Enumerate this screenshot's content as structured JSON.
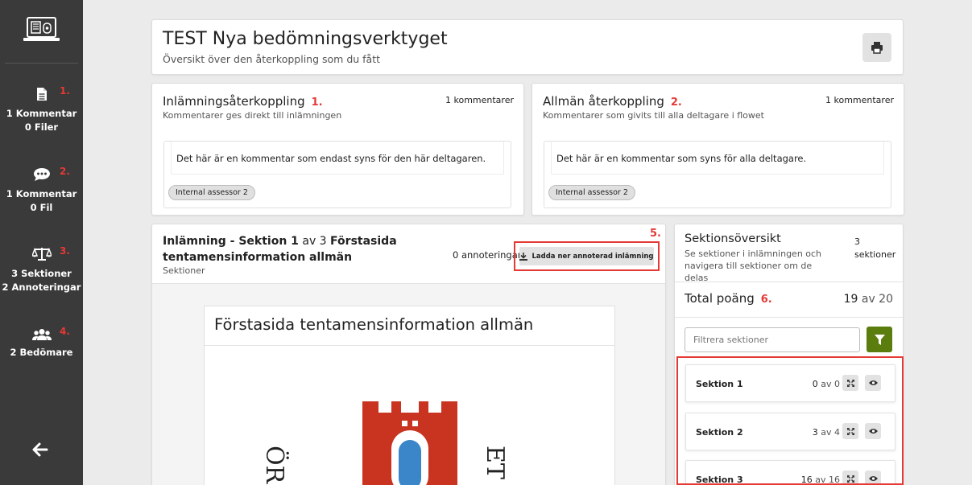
{
  "sidebar": {
    "items": [
      {
        "num": "1.",
        "line1": "1 Kommentar",
        "line2": "0 Filer",
        "icon": "file-icon"
      },
      {
        "num": "2.",
        "line1": "1 Kommentar",
        "line2": "0 Fil",
        "icon": "comment-icon"
      },
      {
        "num": "3.",
        "line1": "3 Sektioner",
        "line2": "2 Annoteringar",
        "icon": "scale-icon"
      },
      {
        "num": "4.",
        "line1": "2 Bedömare",
        "line2": "",
        "icon": "users-icon"
      }
    ]
  },
  "header": {
    "title": "TEST Nya bedömningsverktyget",
    "subtitle": "Översikt över den återkoppling som du fått"
  },
  "submission_feedback": {
    "title": "Inlämningsåterkoppling",
    "num": "1.",
    "subtitle": "Kommentarer ges direkt till inlämningen",
    "count": "1 kommentarer",
    "comment": "Det här är en kommentar som endast syns för den här deltagaren.",
    "assessor": "Internal assessor 2"
  },
  "general_feedback": {
    "title": "Allmän återkoppling",
    "num": "2.",
    "subtitle": "Kommentarer som givits till alla deltagare i flowet",
    "count": "1 kommentarer",
    "comment": "Det här är en kommentar som syns för alla deltagare.",
    "assessor": "Internal assessor 2"
  },
  "submission": {
    "title_prefix": "Inlämning - Sektion 1",
    "title_of": "av 3",
    "title_name": "Förstasida tentamensinformation allmän",
    "subtitle": "Sektioner",
    "annotations": "0 annoteringar",
    "download_label": "Ladda ner annoterad inlämning",
    "num": "5.",
    "doc_title": "Förstasida tentamensinformation allmän",
    "doc_left_text": "ÖR",
    "doc_right_text": "ET"
  },
  "sections": {
    "title": "Sektionsöversikt",
    "subtitle": "Se sektioner i inlämningen och navigera till sektioner om de delas",
    "count_num": "3",
    "count_label": "sektioner",
    "total_label": "Total poäng",
    "total_num": "6.",
    "total_score": "19",
    "total_of": "av 20",
    "filter_placeholder": "Filtrera sektioner",
    "items": [
      {
        "name": "Sektion 1",
        "score": "0",
        "of": "av 0"
      },
      {
        "name": "Sektion 2",
        "score": "3",
        "of": "av 4"
      },
      {
        "name": "Sektion 3",
        "score": "16",
        "of": "av 16"
      }
    ]
  },
  "colors": {
    "accent_red": "#e53935",
    "sidebar_bg": "#3a3a3a",
    "filter_green": "#5a7d0d",
    "emblem_red": "#c8341f",
    "emblem_blue": "#3a86c8"
  }
}
